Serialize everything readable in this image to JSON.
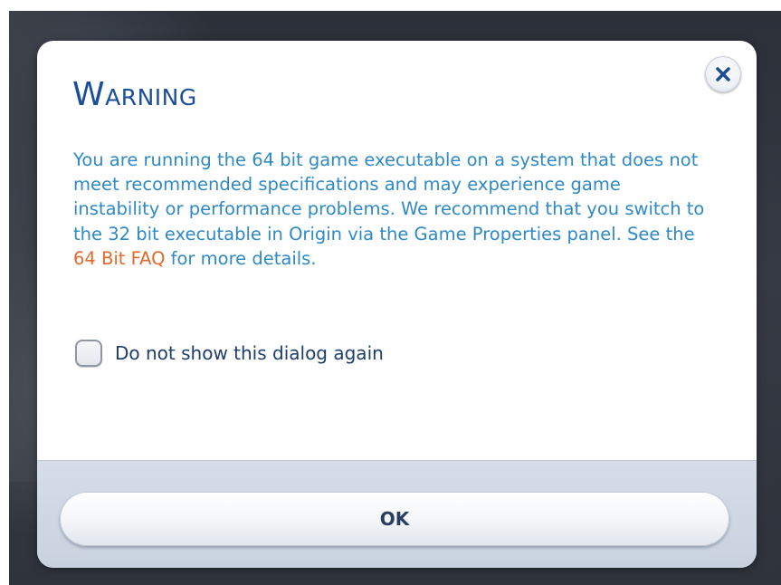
{
  "dialog": {
    "title": "Warning",
    "message": {
      "before_link": "You are running the 64 bit game executable on a system that does not meet recommended specifications and may experience game instability or performance problems.  We recommend that you switch to the 32 bit executable in Origin via the Game Properties panel.  See the ",
      "link_text": "64 Bit FAQ",
      "after_link": " for more details."
    },
    "checkbox": {
      "label": "Do not show this dialog again",
      "checked": false
    },
    "ok_label": "OK",
    "close_icon": "close-icon"
  },
  "colors": {
    "title": "#1b4f99",
    "message": "#2f89c5",
    "link": "#e2692b",
    "checkbox_label": "#1d3d6b",
    "footer": "#d0d8e4",
    "backdrop": "#32363f"
  }
}
